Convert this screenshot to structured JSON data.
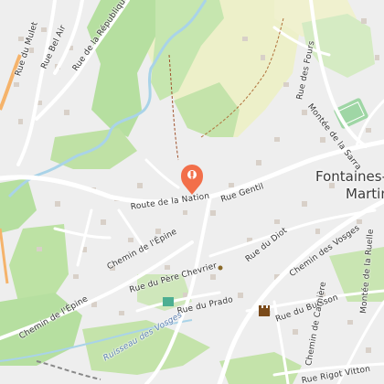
{
  "map": {
    "place_name": [
      "Fontaines-S",
      "Martin"
    ],
    "marker_icon": "map-pin-marker",
    "streets": [
      "Rue du Mulet",
      "Rue Bel Air",
      "Rue de la République",
      "Rue des Fours",
      "Montée de la Sarra",
      "Route de la Nation",
      "Rue Gentil",
      "Chemin de l'Épine",
      "Rue du Diot",
      "Chemin des Vosges",
      "Rue du Père Chevrier",
      "Rue du Prado",
      "Rue du Buisson",
      "Chemin de Carnière",
      "Montée de la Ruelle",
      "Chemin de l'Épine",
      "Rue Rigot Vitton"
    ],
    "waterway": "Ruisseau des Vosges",
    "colors": {
      "background": "#eeeeee",
      "forest": "#b6dfa0",
      "meadow": "#edf0c9",
      "water": "#a9d3e8",
      "road": "#ffffff",
      "buildings": "#d8d0c8",
      "marker": "#f26f4a"
    },
    "icons": [
      "map-pin-marker",
      "sports-pitch-icon",
      "castle-icon",
      "school-icon",
      "viewpoint-icon"
    ]
  }
}
